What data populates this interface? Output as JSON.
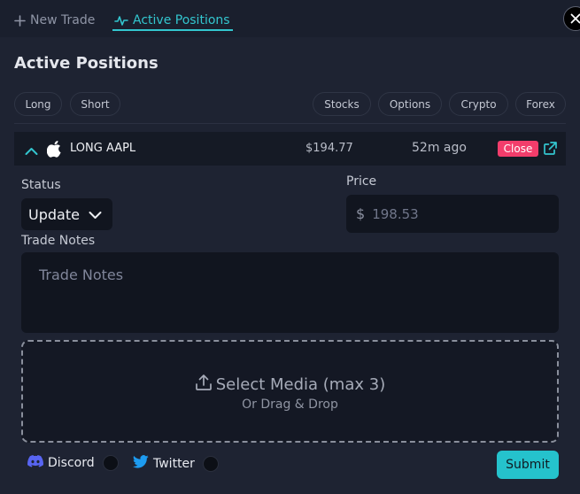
{
  "tabs": {
    "new_trade": "New Trade",
    "active_positions": "Active Positions"
  },
  "page": {
    "title": "Active Positions"
  },
  "filters": {
    "side": [
      "Long",
      "Short"
    ],
    "asset": [
      "Stocks",
      "Options",
      "Crypto",
      "Forex"
    ]
  },
  "position": {
    "label": "LONG AAPL",
    "price": "$194.77",
    "time_ago": "52m ago",
    "close_label": "Close"
  },
  "form": {
    "status_label": "Status",
    "status_value": "Update",
    "price_label": "Price",
    "price_currency": "$",
    "price_placeholder": "198.53",
    "notes_label": "Trade Notes",
    "notes_placeholder": "Trade Notes"
  },
  "media": {
    "title": "Select Media (max 3)",
    "subtitle": "Or Drag & Drop"
  },
  "share": {
    "discord": "Discord",
    "twitter": "Twitter"
  },
  "submit_label": "Submit",
  "colors": {
    "accent": "#33c6cf",
    "close_button": "#f23d6b",
    "submit_button": "#25c2cc",
    "discord": "#5865f2",
    "twitter": "#1d9bf0"
  },
  "icons": [
    "plus-icon",
    "pulse-icon",
    "close-icon",
    "chevron-up-icon",
    "apple-logo-icon",
    "external-link-icon",
    "chevron-down-icon",
    "upload-icon",
    "discord-icon",
    "twitter-icon"
  ]
}
